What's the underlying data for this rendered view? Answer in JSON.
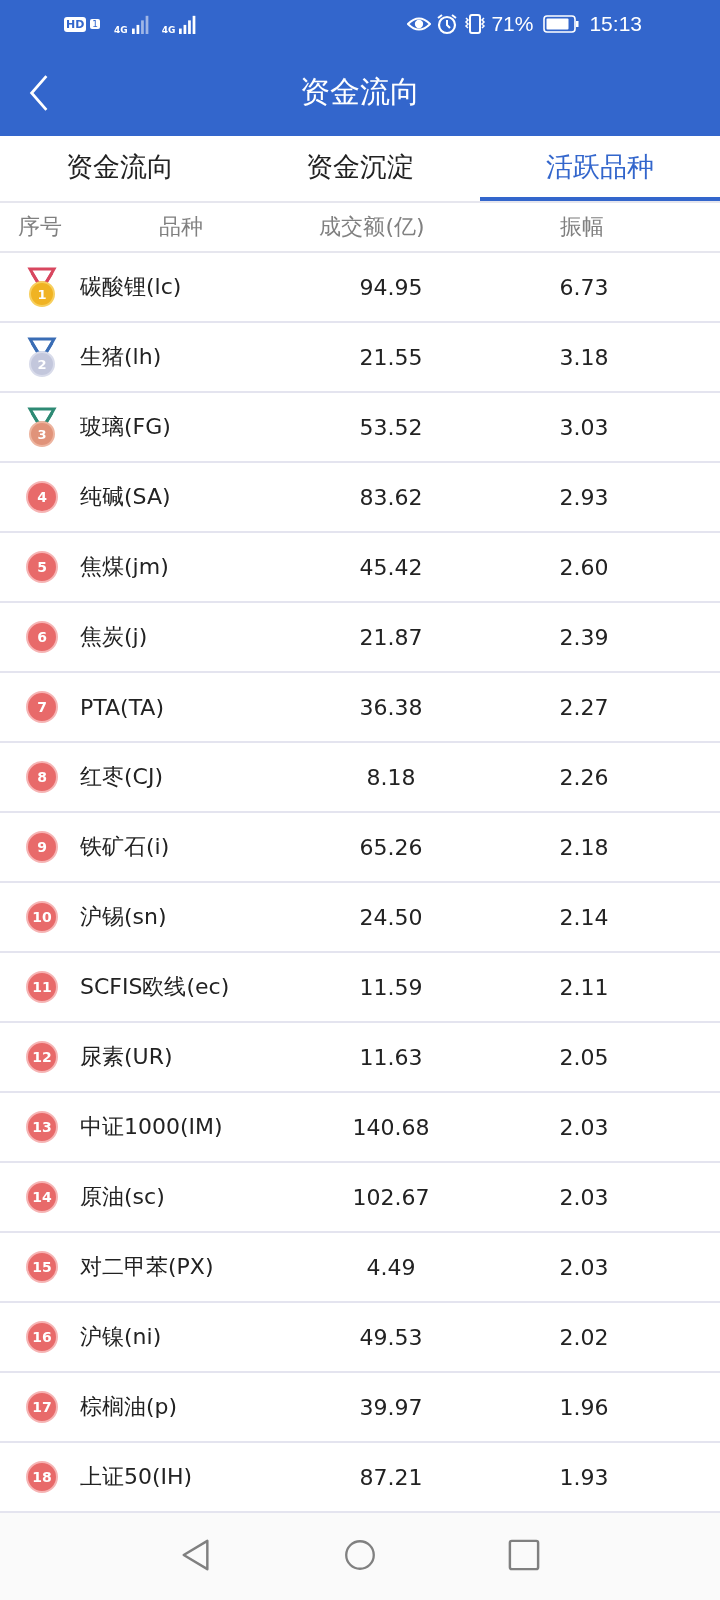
{
  "status_bar": {
    "hd": "HD",
    "sim": "1",
    "network_1": "4G",
    "network_2": "4G",
    "battery": "71%",
    "time": "15:13"
  },
  "header": {
    "title": "资金流向"
  },
  "tabs": [
    {
      "label": "资金流向",
      "selected": false
    },
    {
      "label": "资金沉淀",
      "selected": false
    },
    {
      "label": "活跃品种",
      "selected": true
    }
  ],
  "table": {
    "columns": [
      "序号",
      "品种",
      "成交额(亿)",
      "振幅"
    ],
    "rows": [
      {
        "rank": "1",
        "kind": "gold",
        "name": "碳酸锂(lc)",
        "turnover": "94.95",
        "amplitude": "6.73"
      },
      {
        "rank": "2",
        "kind": "silver",
        "name": "生猪(lh)",
        "turnover": "21.55",
        "amplitude": "3.18"
      },
      {
        "rank": "3",
        "kind": "bronze",
        "name": "玻璃(FG)",
        "turnover": "53.52",
        "amplitude": "3.03"
      },
      {
        "rank": "4",
        "kind": "number",
        "name": "纯碱(SA)",
        "turnover": "83.62",
        "amplitude": "2.93"
      },
      {
        "rank": "5",
        "kind": "number",
        "name": "焦煤(jm)",
        "turnover": "45.42",
        "amplitude": "2.60"
      },
      {
        "rank": "6",
        "kind": "number",
        "name": "焦炭(j)",
        "turnover": "21.87",
        "amplitude": "2.39"
      },
      {
        "rank": "7",
        "kind": "number",
        "name": "PTA(TA)",
        "turnover": "36.38",
        "amplitude": "2.27"
      },
      {
        "rank": "8",
        "kind": "number",
        "name": "红枣(CJ)",
        "turnover": "8.18",
        "amplitude": "2.26"
      },
      {
        "rank": "9",
        "kind": "number",
        "name": "铁矿石(i)",
        "turnover": "65.26",
        "amplitude": "2.18"
      },
      {
        "rank": "10",
        "kind": "number",
        "name": "沪锡(sn)",
        "turnover": "24.50",
        "amplitude": "2.14"
      },
      {
        "rank": "11",
        "kind": "number",
        "name": "SCFIS欧线(ec)",
        "turnover": "11.59",
        "amplitude": "2.11"
      },
      {
        "rank": "12",
        "kind": "number",
        "name": "尿素(UR)",
        "turnover": "11.63",
        "amplitude": "2.05"
      },
      {
        "rank": "13",
        "kind": "number",
        "name": "中证1000(IM)",
        "turnover": "140.68",
        "amplitude": "2.03"
      },
      {
        "rank": "14",
        "kind": "number",
        "name": "原油(sc)",
        "turnover": "102.67",
        "amplitude": "2.03"
      },
      {
        "rank": "15",
        "kind": "number",
        "name": "对二甲苯(PX)",
        "turnover": "4.49",
        "amplitude": "2.03"
      },
      {
        "rank": "16",
        "kind": "number",
        "name": "沪镍(ni)",
        "turnover": "49.53",
        "amplitude": "2.02"
      },
      {
        "rank": "17",
        "kind": "number",
        "name": "棕榈油(p)",
        "turnover": "39.97",
        "amplitude": "1.96"
      },
      {
        "rank": "18",
        "kind": "number",
        "name": "上证50(IH)",
        "turnover": "87.21",
        "amplitude": "1.93"
      }
    ]
  }
}
